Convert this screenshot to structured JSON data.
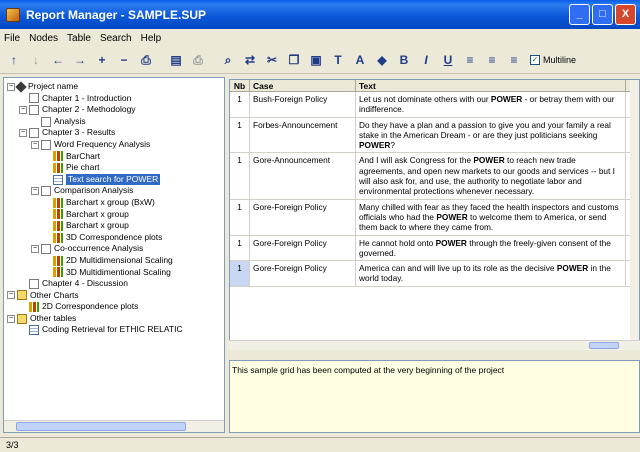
{
  "window": {
    "title": "Report Manager - SAMPLE.SUP",
    "minimize": "_",
    "maximize": "□",
    "close": "X"
  },
  "menu": [
    "File",
    "Nodes",
    "Table",
    "Search",
    "Help"
  ],
  "toolbar": {
    "icons_left": [
      "up-arrow-icon",
      "down-arrow-icon",
      "left-arrow-icon",
      "right-arrow-icon",
      "add-icon",
      "remove-icon",
      "print-preview-icon"
    ],
    "icons_right": [
      "copy-table-icon",
      "print-icon",
      "find-icon",
      "replace-icon",
      "cut-icon",
      "copy-icon",
      "paste-icon",
      "font-icon",
      "underline-color-icon",
      "highlight-icon",
      "bold-icon",
      "italic-icon",
      "underline-icon",
      "align-left-icon",
      "align-center-icon",
      "align-right-icon"
    ],
    "glyphs": {
      "up": "↑",
      "down": "↓",
      "left": "←",
      "right": "→",
      "add": "+",
      "remove": "−",
      "preview": "⎙",
      "find": "♠",
      "cut": "✂",
      "bold": "B",
      "italic": "I",
      "underline": "U"
    },
    "multiline_label": "Multiline",
    "multiline_checked": true
  },
  "tree": [
    {
      "level": 0,
      "twist": "−",
      "icon": "root",
      "label": "Project name"
    },
    {
      "level": 1,
      "twist": "",
      "icon": "doc",
      "label": "Chapter 1 - Introduction"
    },
    {
      "level": 1,
      "twist": "−",
      "icon": "doc",
      "label": "Chapter 2 - Methodology"
    },
    {
      "level": 2,
      "twist": "",
      "icon": "doc",
      "label": "Analysis"
    },
    {
      "level": 1,
      "twist": "−",
      "icon": "doc",
      "label": "Chapter 3 - Results"
    },
    {
      "level": 2,
      "twist": "−",
      "icon": "doc",
      "label": "Word Frequency Analysis"
    },
    {
      "level": 3,
      "twist": "",
      "icon": "chart",
      "label": "BarChart"
    },
    {
      "level": 3,
      "twist": "",
      "icon": "chart",
      "label": "Pie chart"
    },
    {
      "level": 3,
      "twist": "",
      "icon": "table",
      "label": "Text search for POWER",
      "selected": true
    },
    {
      "level": 2,
      "twist": "−",
      "icon": "doc",
      "label": "Comparison Analysis"
    },
    {
      "level": 3,
      "twist": "",
      "icon": "chart",
      "label": "Barchart x group (BxW)"
    },
    {
      "level": 3,
      "twist": "",
      "icon": "chart",
      "label": "Barchart x group"
    },
    {
      "level": 3,
      "twist": "",
      "icon": "chart",
      "label": "Barchart x group"
    },
    {
      "level": 3,
      "twist": "",
      "icon": "chart",
      "label": "3D Correspondence plots"
    },
    {
      "level": 2,
      "twist": "−",
      "icon": "doc",
      "label": "Co-occurrence Analysis"
    },
    {
      "level": 3,
      "twist": "",
      "icon": "chart",
      "label": "2D Multidimensional Scaling"
    },
    {
      "level": 3,
      "twist": "",
      "icon": "chart",
      "label": "3D Multidimentional Scaling"
    },
    {
      "level": 1,
      "twist": "",
      "icon": "doc",
      "label": "Chapter 4 - Discussion"
    },
    {
      "level": 0,
      "twist": "−",
      "icon": "folder",
      "label": "Other Charts"
    },
    {
      "level": 1,
      "twist": "",
      "icon": "chart",
      "label": "2D Correspondence plots"
    },
    {
      "level": 0,
      "twist": "−",
      "icon": "folder",
      "label": "Other tables"
    },
    {
      "level": 1,
      "twist": "",
      "icon": "table",
      "label": "Coding Retrieval for ETHIC RELATIC"
    }
  ],
  "grid": {
    "columns": [
      "Nb",
      "Case",
      "Text"
    ],
    "rows": [
      {
        "nb": "1",
        "case": "Bush-Foreign Policy",
        "text_before": "Let us not dominate others with our ",
        "keyword": "POWER",
        "text_after": " - or betray them with our indifference."
      },
      {
        "nb": "1",
        "case": "Forbes-Announcement",
        "text_before": "Do they have a plan and a passion to give you and your family a real stake in the American Dream - or are they just politicians seeking ",
        "keyword": "POWER",
        "text_after": "?"
      },
      {
        "nb": "1",
        "case": "Gore-Announcement",
        "text_before": "And I will ask Congress for the ",
        "keyword": "POWER",
        "text_after": " to reach new trade agreements, and open new markets to our goods and services -- but I will also ask for, and use, the authority to negotiate labor and environmental protections whenever necessary."
      },
      {
        "nb": "1",
        "case": "Gore-Foreign Policy",
        "text_before": "Many chilled with fear as they faced the health inspectors and customs officials who had the ",
        "keyword": "POWER",
        "text_after": " to welcome them to America, or send them back to where they came from."
      },
      {
        "nb": "1",
        "case": "Gore-Foreign Policy",
        "text_before": "He cannot hold onto ",
        "keyword": "POWER",
        "text_after": " through the freely-given consent of the governed."
      },
      {
        "nb": "1",
        "case": "Gore-Foreign Policy",
        "text_before": "America can and will live up to its role as the decisive ",
        "keyword": "POWER",
        "text_after": " in the world today.",
        "current": true
      }
    ]
  },
  "notes": "This sample grid has been computed at the very beginning of the project",
  "status": "3/3"
}
